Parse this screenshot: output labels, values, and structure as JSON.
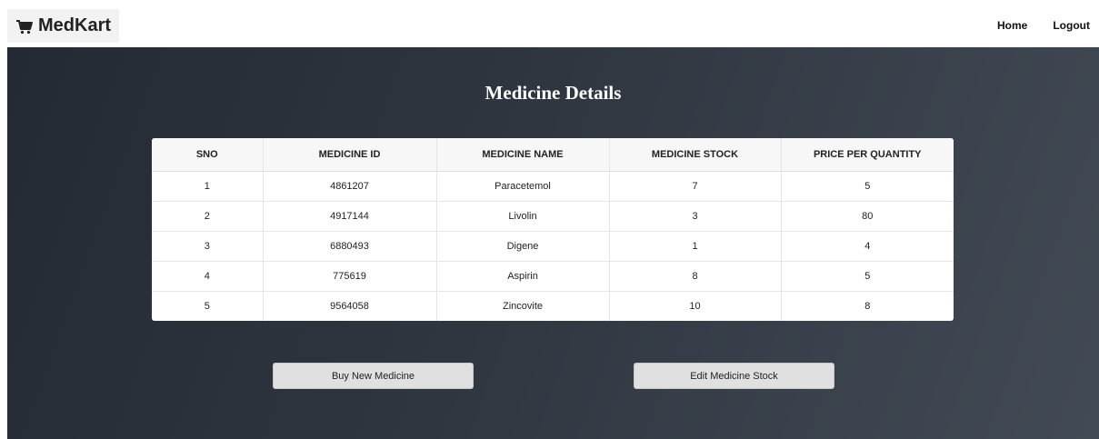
{
  "navbar": {
    "brand": "MedKart",
    "brand_icon": "shopping-cart-icon",
    "links": [
      "Home",
      "Logout"
    ]
  },
  "main": {
    "title": "Medicine Details",
    "table": {
      "headers": [
        "SNO",
        "MEDICINE ID",
        "MEDICINE NAME",
        "MEDICINE STOCK",
        "PRICE PER QUANTITY"
      ],
      "rows": [
        [
          "1",
          "4861207",
          "Paracetemol",
          "7",
          "5"
        ],
        [
          "2",
          "4917144",
          "Livolin",
          "3",
          "80"
        ],
        [
          "3",
          "6880493",
          "Digene",
          "1",
          "4"
        ],
        [
          "4",
          "775619",
          "Aspirin",
          "8",
          "5"
        ],
        [
          "5",
          "9564058",
          "Zincovite",
          "10",
          "8"
        ]
      ]
    },
    "buttons": {
      "buy": "Buy New Medicine",
      "edit": "Edit Medicine Stock"
    }
  }
}
